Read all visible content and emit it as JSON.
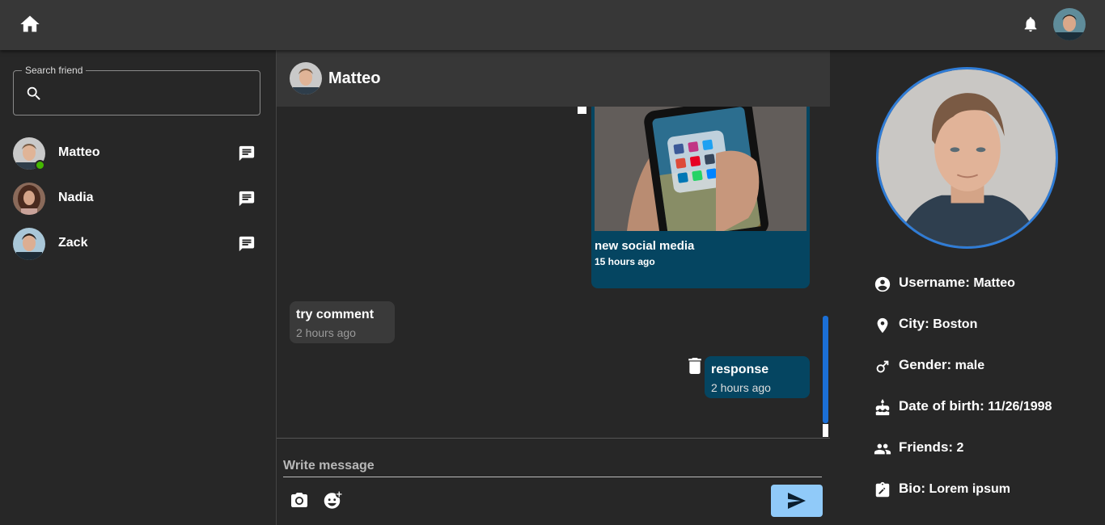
{
  "sidebar": {
    "search_label": "Search friend",
    "friends": [
      {
        "name": "Matteo",
        "online": true
      },
      {
        "name": "Nadia",
        "online": false
      },
      {
        "name": "Zack",
        "online": false
      }
    ]
  },
  "chat": {
    "header_name": "Matteo",
    "messages": [
      {
        "text": "new social media",
        "time": "15 hours ago",
        "side": "right",
        "has_image": true
      },
      {
        "text": "try comment",
        "time": "2 hours ago",
        "side": "left"
      },
      {
        "text": "response",
        "time": "2 hours ago",
        "side": "right"
      }
    ],
    "composer_placeholder": "Write message"
  },
  "profile": {
    "username_label": "Username:",
    "username": "Matteo",
    "city_label": "City:",
    "city": "Boston",
    "gender_label": "Gender:",
    "gender": "male",
    "dob_label": "Date of birth:",
    "dob": "11/26/1998",
    "friends_label": "Friends:",
    "friends": "2",
    "bio_label": "Bio:",
    "bio": "Lorem ipsum"
  },
  "colors": {
    "accent_blue": "#2f7cd6",
    "message_bubble_own": "#054561",
    "message_bubble_other": "#3a3a3a",
    "send_button": "#90caf9",
    "online": "#44b700"
  },
  "icons": [
    "home-icon",
    "bell-icon",
    "search-icon",
    "chat-icon",
    "trash-icon",
    "camera-icon",
    "emoji-add-icon",
    "send-icon",
    "account-circle-icon",
    "location-pin-icon",
    "male-icon",
    "cake-icon",
    "people-icon",
    "assignment-icon"
  ]
}
